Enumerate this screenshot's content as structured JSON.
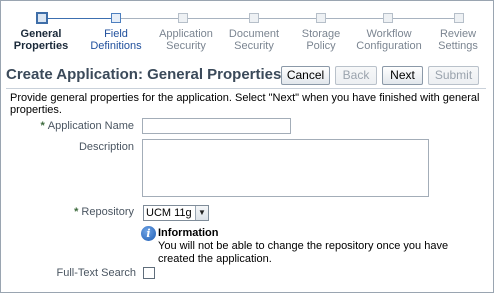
{
  "train": {
    "steps": [
      {
        "label": "General\nProperties",
        "state": "current"
      },
      {
        "label": "Field\nDefinitions",
        "state": "next"
      },
      {
        "label": "Application\nSecurity",
        "state": "disabled"
      },
      {
        "label": "Document\nSecurity",
        "state": "disabled"
      },
      {
        "label": "Storage\nPolicy",
        "state": "disabled"
      },
      {
        "label": "Workflow\nConfiguration",
        "state": "disabled"
      },
      {
        "label": "Review\nSettings",
        "state": "disabled"
      }
    ]
  },
  "header": {
    "title": "Create Application: General Properties",
    "buttons": {
      "cancel": "Cancel",
      "back": "Back",
      "next": "Next",
      "submit": "Submit"
    }
  },
  "instructions": "Provide general properties for the application. Select \"Next\" when you have finished with general properties.",
  "form": {
    "required_marker": "*",
    "application_name": {
      "label": "Application Name",
      "value": ""
    },
    "description": {
      "label": "Description",
      "value": ""
    },
    "repository": {
      "label": "Repository",
      "selected": "UCM 11g"
    },
    "info": {
      "title": "Information",
      "text": "You will not be able to change the repository once you have created the application."
    },
    "full_text_search": {
      "label": "Full-Text Search",
      "checked": false
    }
  },
  "colors": {
    "title_text": "#3b4a5a",
    "train_active": "#3c6fb0",
    "link_blue": "#1f4f9c",
    "required_star": "#3c6a3c"
  }
}
